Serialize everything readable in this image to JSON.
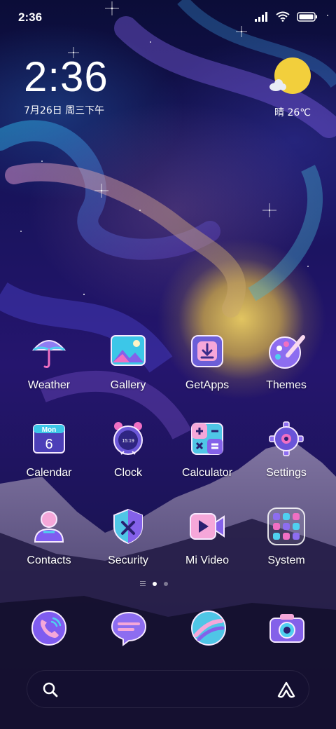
{
  "status_bar": {
    "time": "2:36"
  },
  "clock_widget": {
    "time": "2:36",
    "date": "7月26日 周三下午"
  },
  "weather_widget": {
    "text": "晴 26℃"
  },
  "apps": [
    {
      "name": "weather",
      "label": "Weather",
      "icon": "umbrella-icon"
    },
    {
      "name": "gallery",
      "label": "Gallery",
      "icon": "picture-icon"
    },
    {
      "name": "getapps",
      "label": "GetApps",
      "icon": "download-box-icon"
    },
    {
      "name": "themes",
      "label": "Themes",
      "icon": "palette-icon"
    },
    {
      "name": "calendar",
      "label": "Calendar",
      "icon": "calendar-icon",
      "badge_day": "Mon",
      "badge_date": "6"
    },
    {
      "name": "clock",
      "label": "Clock",
      "icon": "alarm-clock-icon",
      "badge_time": "15:19"
    },
    {
      "name": "calculator",
      "label": "Calculator",
      "icon": "calculator-icon"
    },
    {
      "name": "settings",
      "label": "Settings",
      "icon": "gear-icon"
    },
    {
      "name": "contacts",
      "label": "Contacts",
      "icon": "person-icon"
    },
    {
      "name": "security",
      "label": "Security",
      "icon": "shield-icon"
    },
    {
      "name": "mivideo",
      "label": "Mi Video",
      "icon": "video-play-icon"
    },
    {
      "name": "system",
      "label": "System",
      "icon": "folder-grid-icon"
    }
  ],
  "dock": [
    {
      "name": "phone",
      "icon": "phone-icon"
    },
    {
      "name": "messages",
      "icon": "message-icon"
    },
    {
      "name": "browser",
      "icon": "browser-icon"
    },
    {
      "name": "camera",
      "icon": "camera-icon"
    }
  ],
  "colors": {
    "sun": "#f2cf3c",
    "icon_pink": "#f06fc3",
    "icon_cyan": "#56d8f0",
    "icon_purple": "#7f5cf0"
  }
}
